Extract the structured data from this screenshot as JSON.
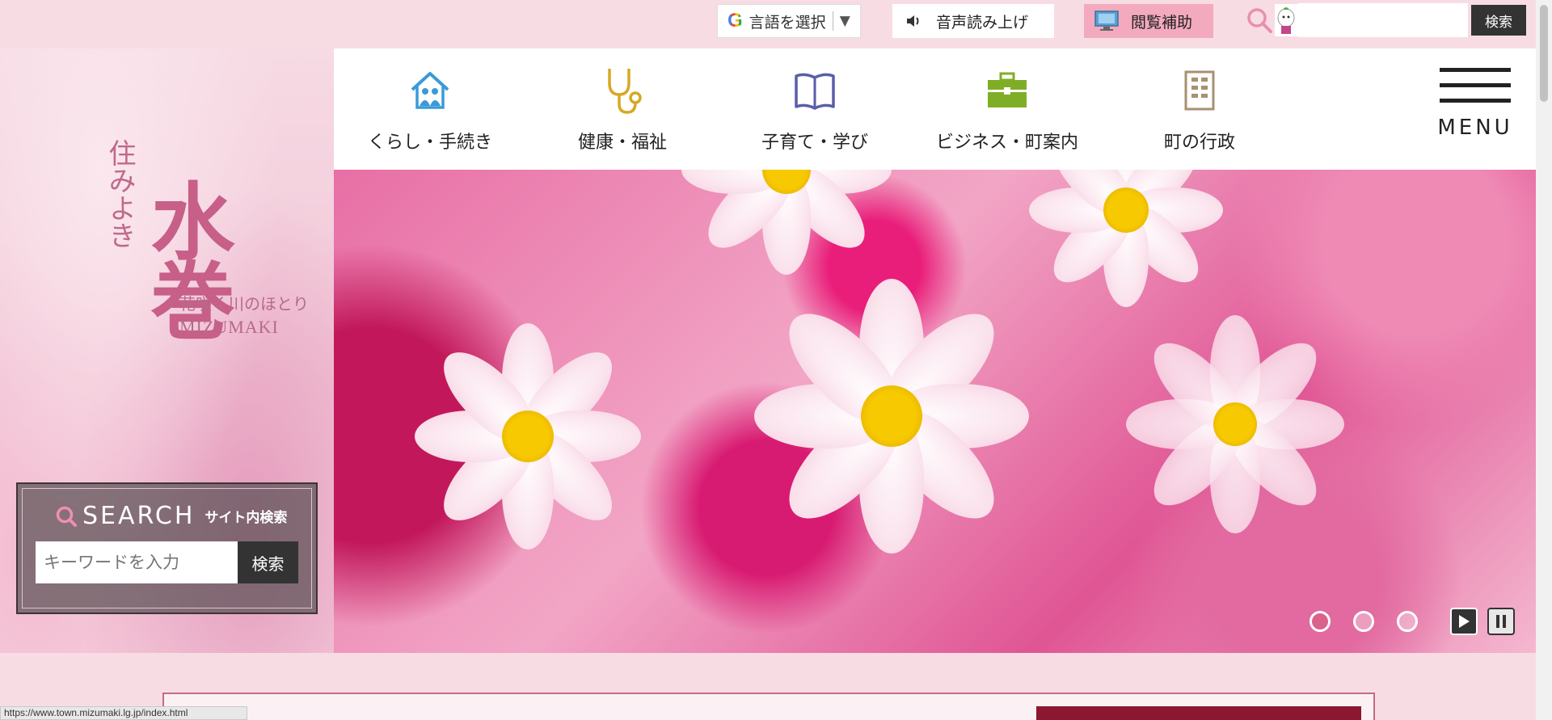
{
  "topbar": {
    "translate_label": "言語を選択",
    "translate_caret": "▼",
    "translate_logo": "G",
    "speech_label": "音声読み上げ",
    "assist_label": "閲覧補助",
    "search_placeholder": "",
    "search_button": "検索"
  },
  "brand": {
    "logo_small": "住みよき",
    "logo_big": "水巻",
    "tagline": "花咲く川のほとり",
    "roman": "MIZUMAKI"
  },
  "site_search": {
    "title_en": "SEARCH",
    "title_jp": "サイト内検索",
    "placeholder": "キーワードを入力",
    "button": "検索"
  },
  "nav": {
    "items": [
      {
        "label": "くらし・手続き",
        "icon": "house-family-icon",
        "color": "#3a9ad9"
      },
      {
        "label": "健康・福祉",
        "icon": "stethoscope-icon",
        "color": "#d6a824"
      },
      {
        "label": "子育て・学び",
        "icon": "open-book-icon",
        "color": "#5a5ea8"
      },
      {
        "label": "ビジネス・町案内",
        "icon": "briefcase-icon",
        "color": "#7fae26"
      },
      {
        "label": "町の行政",
        "icon": "building-icon",
        "color": "#a89070"
      }
    ],
    "menu_label": "MENU"
  },
  "hero": {
    "slides": 3,
    "active_slide": 1
  },
  "status_bar": {
    "url": "https://www.town.mizumaki.lg.jp/index.html"
  },
  "colors": {
    "background": "#f7dde3",
    "assist": "#f3a9be",
    "accent": "#8b1830"
  }
}
